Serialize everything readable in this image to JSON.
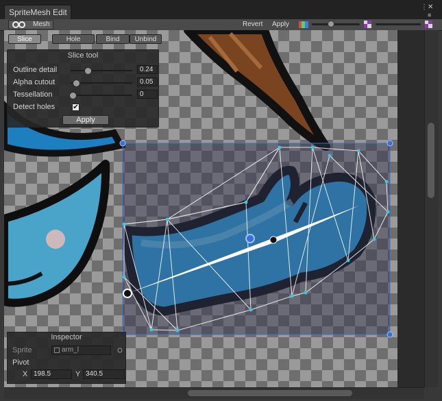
{
  "window": {
    "tab_title": "SpriteMesh Edit",
    "close_glyph": "✕",
    "menu_glyph": "≡"
  },
  "toolbar": {
    "mode_label": "Mesh",
    "revert_label": "Revert",
    "apply_label": "Apply"
  },
  "tools": {
    "slice_label": "Slice",
    "hole_label": "Hole",
    "bind_label": "Bind",
    "unbind_label": "Unbind",
    "active": "slice"
  },
  "slice_tool": {
    "title": "Slice tool",
    "outline_detail": {
      "label": "Outline detail",
      "value": "0.24",
      "level": 0.24
    },
    "alpha_cutout": {
      "label": "Alpha cutout",
      "value": "0.05",
      "level": 0.05
    },
    "tessellation": {
      "label": "Tessellation",
      "value": "0",
      "level": 0
    },
    "detect_holes": {
      "label": "Detect holes",
      "checked": true,
      "check_glyph": "✔"
    },
    "apply_label": "Apply"
  },
  "inspector": {
    "title": "Inspector",
    "sprite_label": "Sprite",
    "sprite_value": "arm_l",
    "pivot_label": "Pivot",
    "pivot_x_label": "X",
    "pivot_x": "198.5",
    "pivot_y_label": "Y",
    "pivot_y": "340.5"
  },
  "colors": {
    "selection": "#3a6fd8",
    "mesh_line": "#ffffff",
    "vertex": "#3ec6e0",
    "sprite_blue": "#2aa8e8",
    "outline": "#1a1a1a"
  }
}
